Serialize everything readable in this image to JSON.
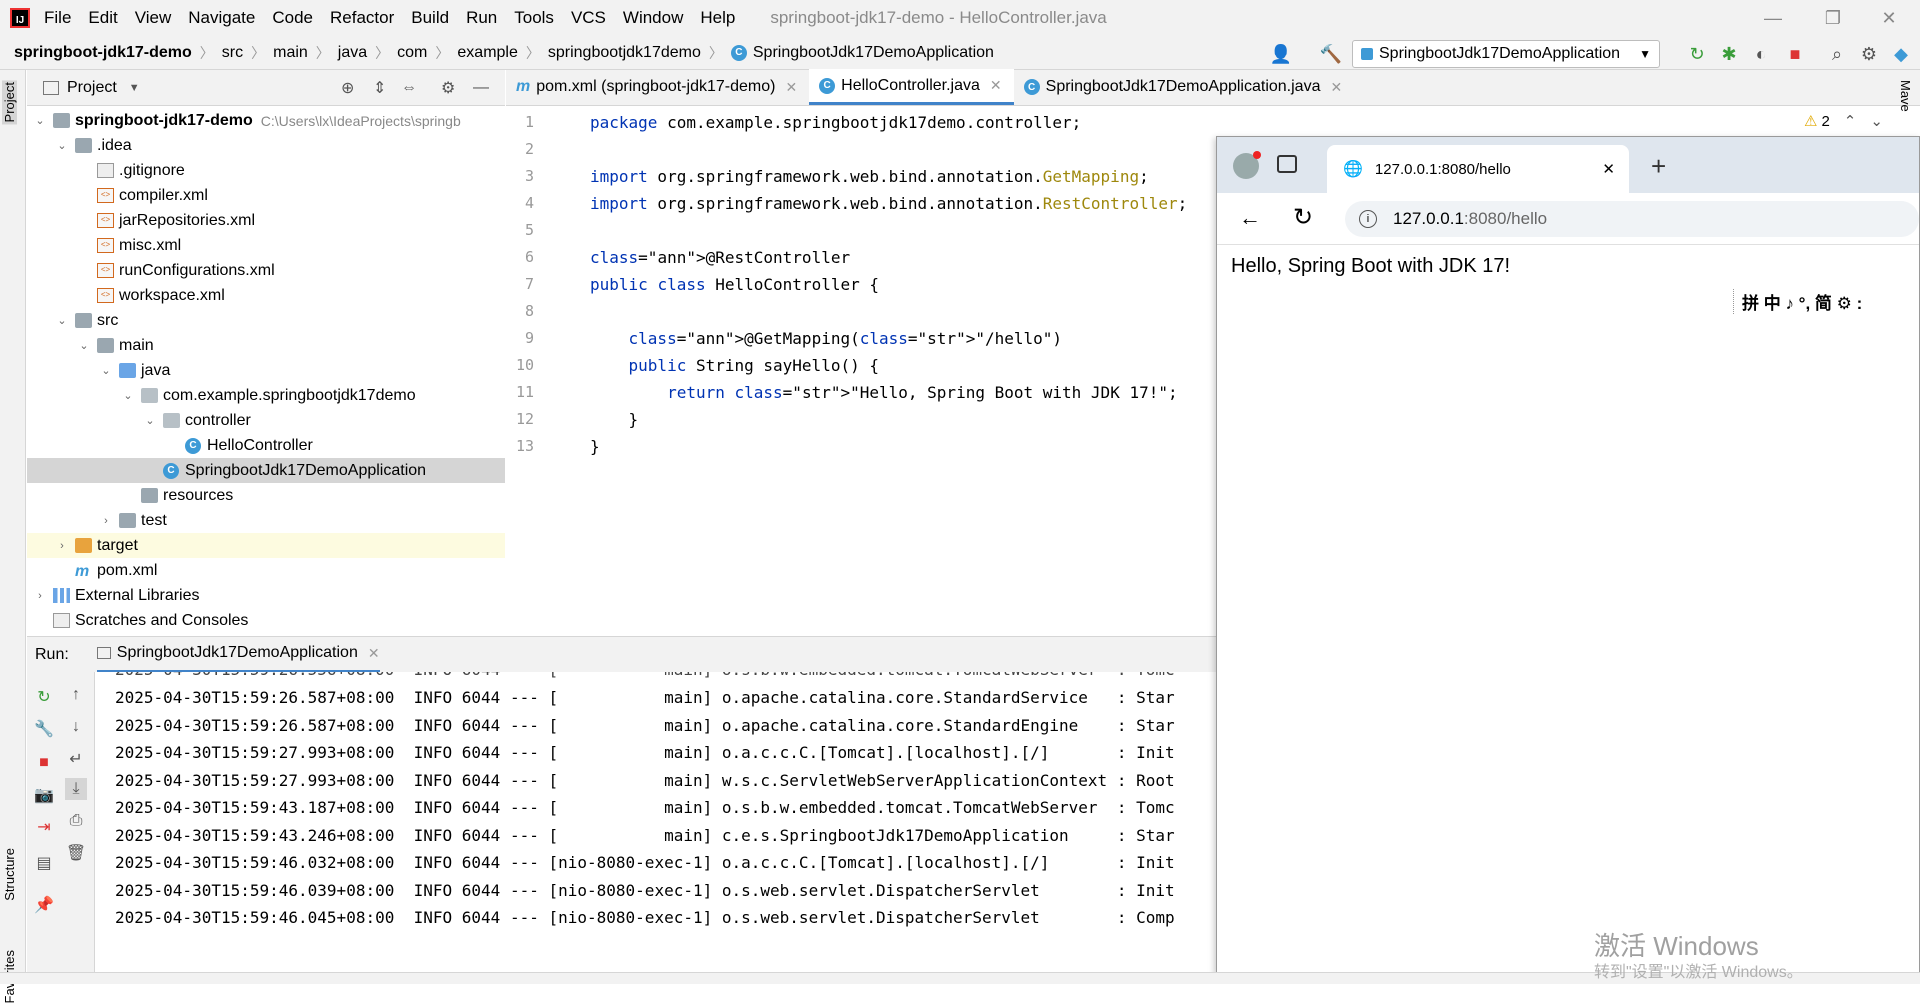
{
  "menubar": {
    "items": [
      "File",
      "Edit",
      "View",
      "Navigate",
      "Code",
      "Refactor",
      "Build",
      "Run",
      "Tools",
      "VCS",
      "Window",
      "Help"
    ],
    "window_title": "springboot-jdk17-demo - HelloController.java"
  },
  "navbar": {
    "crumbs": [
      "springboot-jdk17-demo",
      "src",
      "main",
      "java",
      "com",
      "example",
      "springbootjdk17demo",
      "SpringbootJdk17DemoApplication"
    ],
    "run_config": "SpringbootJdk17DemoApplication"
  },
  "left_strip": {
    "project": "Project",
    "structure": "Structure",
    "favorites": "Favorites"
  },
  "project_panel": {
    "title": "Project",
    "tree": [
      {
        "label": "springboot-jdk17-demo",
        "extra": "C:\\Users\\lx\\IdeaProjects\\springb",
        "depth": 0,
        "icon": "folder-icon",
        "expanded": true
      },
      {
        "label": ".idea",
        "depth": 1,
        "icon": "folder-icon",
        "expanded": true
      },
      {
        "label": ".gitignore",
        "depth": 2,
        "icon": "gitignore-file-icon"
      },
      {
        "label": "compiler.xml",
        "depth": 2,
        "icon": "xml-file-icon"
      },
      {
        "label": "jarRepositories.xml",
        "depth": 2,
        "icon": "xml-file-icon"
      },
      {
        "label": "misc.xml",
        "depth": 2,
        "icon": "xml-file-icon"
      },
      {
        "label": "runConfigurations.xml",
        "depth": 2,
        "icon": "xml-file-icon"
      },
      {
        "label": "workspace.xml",
        "depth": 2,
        "icon": "xml-file-icon"
      },
      {
        "label": "src",
        "depth": 1,
        "icon": "folder-icon",
        "expanded": true
      },
      {
        "label": "main",
        "depth": 2,
        "icon": "folder-icon",
        "expanded": true
      },
      {
        "label": "java",
        "depth": 3,
        "icon": "source-folder-icon",
        "expanded": true
      },
      {
        "label": "com.example.springbootjdk17demo",
        "depth": 4,
        "icon": "package-icon",
        "expanded": true
      },
      {
        "label": "controller",
        "depth": 5,
        "icon": "package-icon",
        "expanded": true
      },
      {
        "label": "HelloController",
        "depth": 6,
        "icon": "class-icon"
      },
      {
        "label": "SpringbootJdk17DemoApplication",
        "depth": 5,
        "icon": "class-icon",
        "selected": true
      },
      {
        "label": "resources",
        "depth": 4,
        "icon": "resources-folder-icon"
      },
      {
        "label": "test",
        "depth": 3,
        "icon": "folder-icon",
        "expanded": false
      },
      {
        "label": "target",
        "depth": 1,
        "icon": "excluded-folder-icon",
        "expanded": false,
        "highlight": true
      },
      {
        "label": "pom.xml",
        "depth": 1,
        "icon": "maven-icon"
      },
      {
        "label": "External Libraries",
        "depth": 0,
        "icon": "library-icon",
        "expanded": false
      },
      {
        "label": "Scratches and Consoles",
        "depth": 0,
        "icon": "scratches-icon"
      }
    ]
  },
  "editor": {
    "tabs": [
      {
        "label": "pom.xml (springboot-jdk17-demo)",
        "icon": "maven-icon"
      },
      {
        "label": "HelloController.java",
        "icon": "class-icon",
        "active": true
      },
      {
        "label": "SpringbootJdk17DemoApplication.java",
        "icon": "class-icon"
      }
    ],
    "warnings": "2",
    "lines": [
      {
        "n": "1",
        "text": "package com.example.springbootjdk17demo.controller;"
      },
      {
        "n": "2",
        "text": ""
      },
      {
        "n": "3",
        "text": "import org.springframework.web.bind.annotation.GetMapping;"
      },
      {
        "n": "4",
        "text": "import org.springframework.web.bind.annotation.RestController;"
      },
      {
        "n": "5",
        "text": ""
      },
      {
        "n": "6",
        "text": "@RestController"
      },
      {
        "n": "7",
        "text": "public class HelloController {"
      },
      {
        "n": "8",
        "text": ""
      },
      {
        "n": "9",
        "text": "    @GetMapping(\"/hello\")"
      },
      {
        "n": "10",
        "text": "    public String sayHello() {"
      },
      {
        "n": "11",
        "text": "        return \"Hello, Spring Boot with JDK 17!\";"
      },
      {
        "n": "12",
        "text": "    }"
      },
      {
        "n": "13",
        "text": "}"
      }
    ]
  },
  "run_panel": {
    "label": "Run:",
    "tab": "SpringbootJdk17DemoApplication",
    "log": [
      "2025-04-30T15:59:26.587+08:00  INFO 6044 --- [           main] o.apache.catalina.core.StandardService   : Star",
      "2025-04-30T15:59:26.587+08:00  INFO 6044 --- [           main] o.apache.catalina.core.StandardEngine    : Star",
      "2025-04-30T15:59:27.993+08:00  INFO 6044 --- [           main] o.a.c.c.C.[Tomcat].[localhost].[/]       : Init",
      "2025-04-30T15:59:27.993+08:00  INFO 6044 --- [           main] w.s.c.ServletWebServerApplicationContext : Root",
      "2025-04-30T15:59:43.187+08:00  INFO 6044 --- [           main] o.s.b.w.embedded.tomcat.TomcatWebServer  : Tomc",
      "2025-04-30T15:59:43.246+08:00  INFO 6044 --- [           main] c.e.s.SpringbootJdk17DemoApplication     : Star",
      "2025-04-30T15:59:46.032+08:00  INFO 6044 --- [nio-8080-exec-1] o.a.c.c.C.[Tomcat].[localhost].[/]       : Init",
      "2025-04-30T15:59:46.039+08:00  INFO 6044 --- [nio-8080-exec-1] o.s.web.servlet.DispatcherServlet        : Init",
      "2025-04-30T15:59:46.045+08:00  INFO 6044 --- [nio-8080-exec-1] o.s.web.servlet.DispatcherServlet        : Comp"
    ]
  },
  "browser": {
    "tab_title": "127.0.0.1:8080/hello",
    "url_host": "127.0.0.1",
    "url_rest": ":8080/hello",
    "body_text": "Hello, Spring Boot with JDK 17!",
    "ime_toolbar": "拼 中 ♪ °, 简 ⚙ :"
  },
  "watermark": {
    "line1": "激活 Windows",
    "line2": "转到\"设置\"以激活 Windows。"
  }
}
